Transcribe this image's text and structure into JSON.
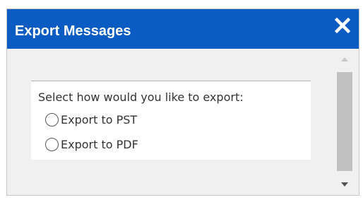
{
  "dialog": {
    "title": "Export Messages",
    "close_icon": "close-icon"
  },
  "content": {
    "instruction": "Select how would you like to export:",
    "options": [
      {
        "label": "Export to PST",
        "selected": false
      },
      {
        "label": "Export to PDF",
        "selected": false
      }
    ]
  },
  "scrollbar": {
    "up_icon": "arrow-up-icon",
    "down_icon": "arrow-down-icon"
  },
  "colors": {
    "titlebar": "#0b5cc2",
    "dialog_background": "#f0f0f0",
    "panel_background": "#ffffff",
    "scroll_thumb": "#c1c1c1"
  }
}
